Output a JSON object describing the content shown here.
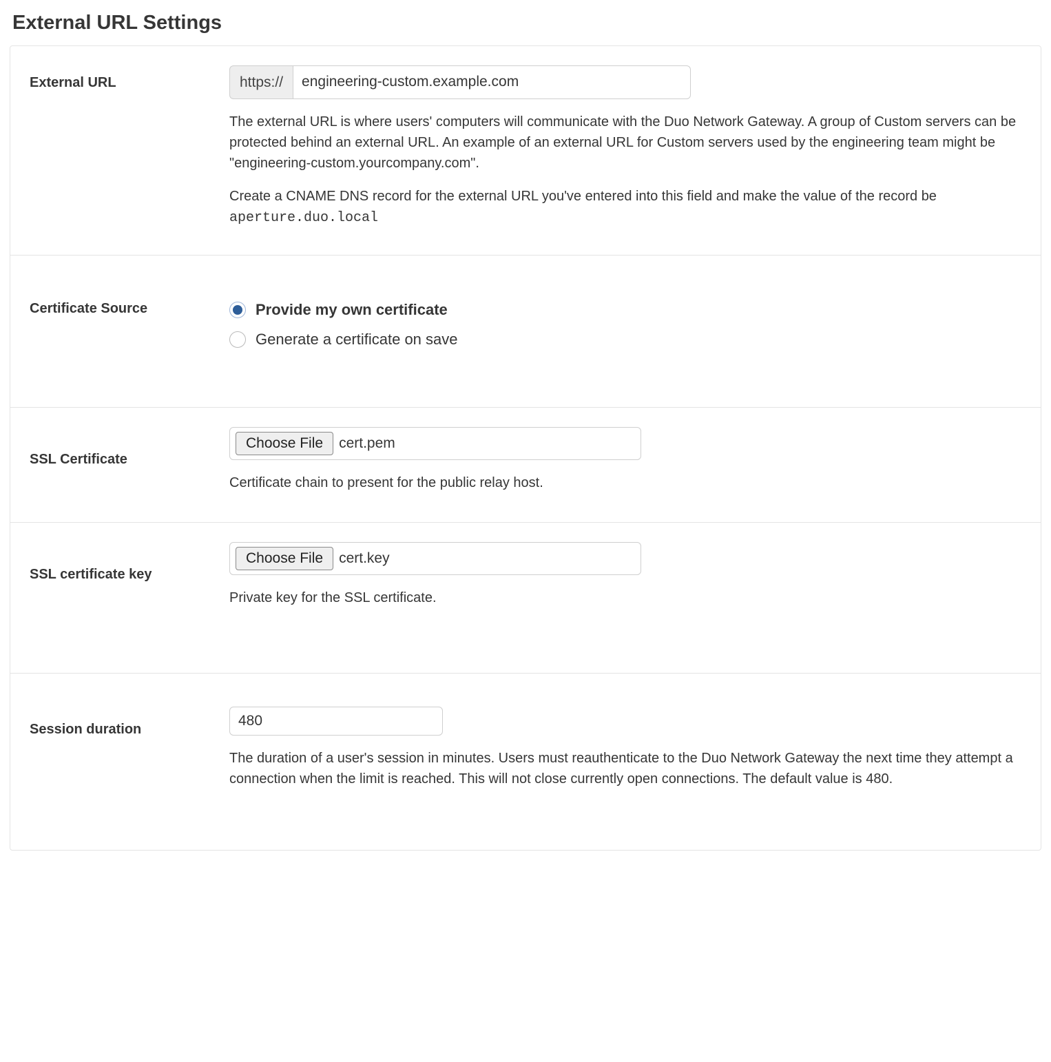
{
  "section_title": "External URL Settings",
  "external_url": {
    "label": "External URL",
    "prefix": "https://",
    "value": "engineering-custom.example.com",
    "help1": "The external URL is where users' computers will communicate with the Duo Network Gateway. A group of Custom servers can be protected behind an external URL. An example of an external URL for Custom servers used by the engineering team might be \"engineering-custom.yourcompany.com\".",
    "help2_pre": "Create a CNAME DNS record for the external URL you've entered into this field and make the value of the record be ",
    "help2_code": "aperture.duo.local"
  },
  "certificate_source": {
    "label": "Certificate Source",
    "options": [
      {
        "label": "Provide my own certificate",
        "checked": true
      },
      {
        "label": "Generate a certificate on save",
        "checked": false
      }
    ]
  },
  "ssl_certificate": {
    "label": "SSL Certificate",
    "button": "Choose File",
    "filename": "cert.pem",
    "help": "Certificate chain to present for the public relay host."
  },
  "ssl_certificate_key": {
    "label": "SSL certificate key",
    "button": "Choose File",
    "filename": "cert.key",
    "help": "Private key for the SSL certificate."
  },
  "session_duration": {
    "label": "Session duration",
    "value": "480",
    "help": "The duration of a user's session in minutes. Users must reauthenticate to the Duo Network Gateway the next time they attempt a connection when the limit is reached. This will not close currently open connections. The default value is 480."
  }
}
